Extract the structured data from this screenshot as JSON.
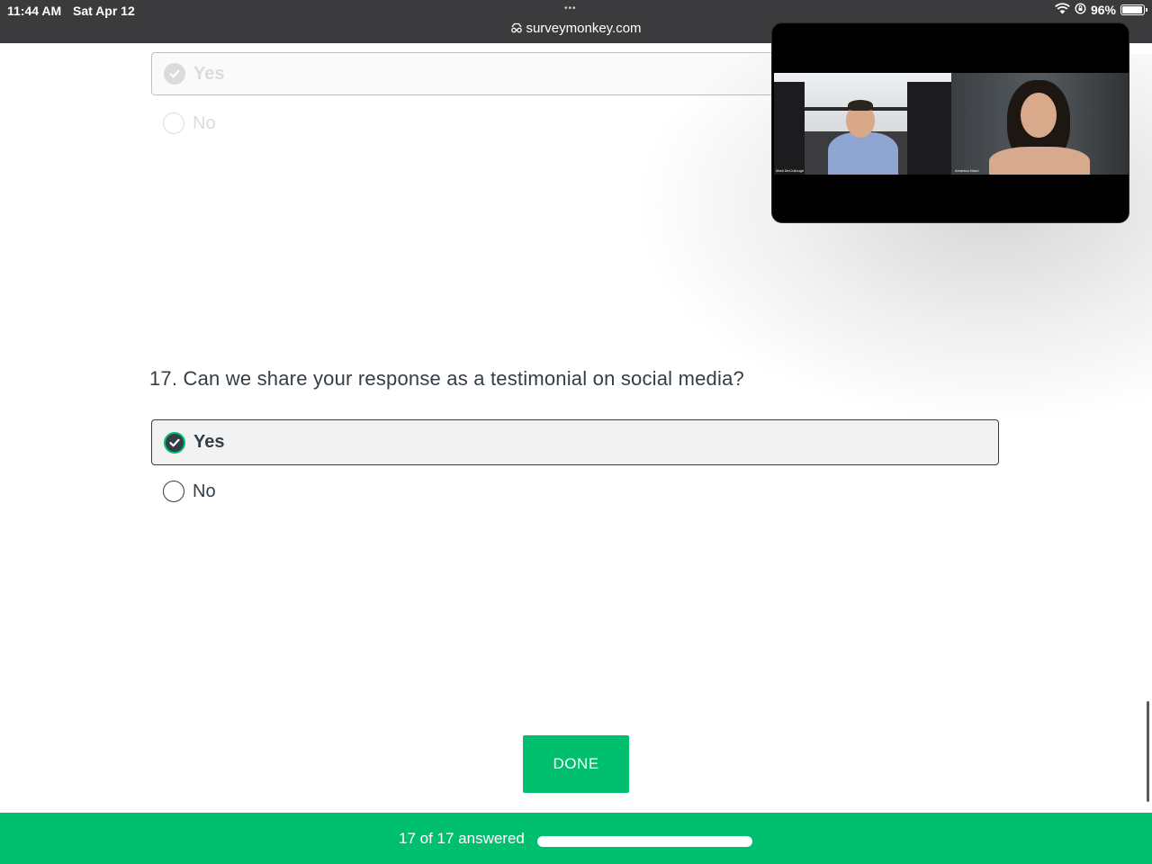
{
  "status_bar": {
    "time": "11:44 AM",
    "date": "Sat Apr 12",
    "battery": "96%",
    "battery_level": 0.96,
    "icons": [
      "wifi-icon",
      "orientation-lock-icon",
      "battery-icon"
    ]
  },
  "browser": {
    "url": "surveymonkey.com",
    "menu_dots": "•••"
  },
  "previous_question": {
    "choices": [
      {
        "label": "Yes",
        "selected": true
      },
      {
        "label": "No",
        "selected": false
      }
    ]
  },
  "question": {
    "number": "17.",
    "text": "Can we share your response as a testimonial on social media?",
    "choices": [
      {
        "label": "Yes",
        "selected": true
      },
      {
        "label": "No",
        "selected": false
      }
    ]
  },
  "done_button": {
    "label": "DONE"
  },
  "progress": {
    "text": "17 of 17 answered",
    "answered": 17,
    "total": 17
  },
  "video_call": {
    "participants": [
      {
        "name": "Mark McCullough"
      },
      {
        "name": "Amanlou Nouri"
      }
    ]
  },
  "colors": {
    "accent": "#00bf6f",
    "text": "#333e48",
    "topbar": "#3b3b3d"
  }
}
